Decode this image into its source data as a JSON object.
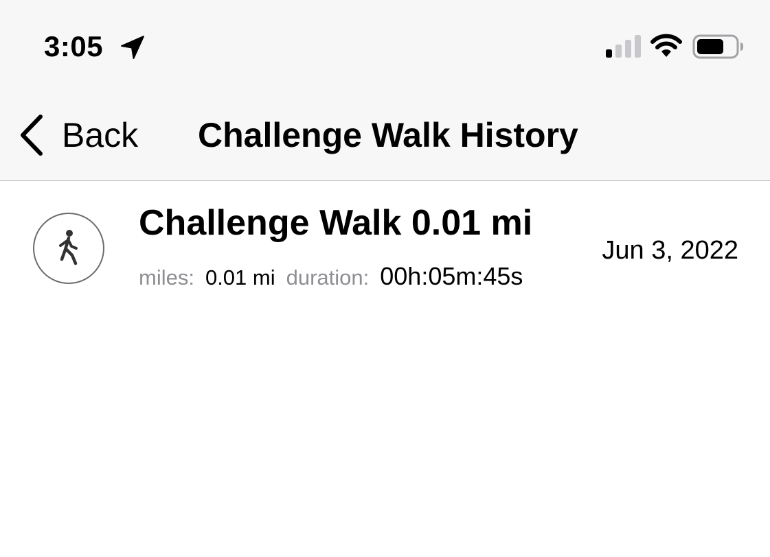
{
  "status_bar": {
    "time": "3:05",
    "icons": [
      "location-arrow-icon",
      "cellular-signal-icon",
      "wifi-icon",
      "battery-icon"
    ]
  },
  "nav": {
    "back_label": "Back",
    "title": "Challenge Walk History"
  },
  "history": {
    "items": [
      {
        "icon": "walking-person-icon",
        "title": "Challenge Walk 0.01 mi",
        "miles_label": "miles:",
        "miles_value": "0.01 mi",
        "duration_label": "duration:",
        "duration_value": "00h:05m:45s",
        "date": "Jun 3, 2022"
      }
    ]
  },
  "colors": {
    "header_background": "#f7f7f7",
    "secondary_text": "#8e8e93",
    "divider": "#b8b8bb"
  }
}
